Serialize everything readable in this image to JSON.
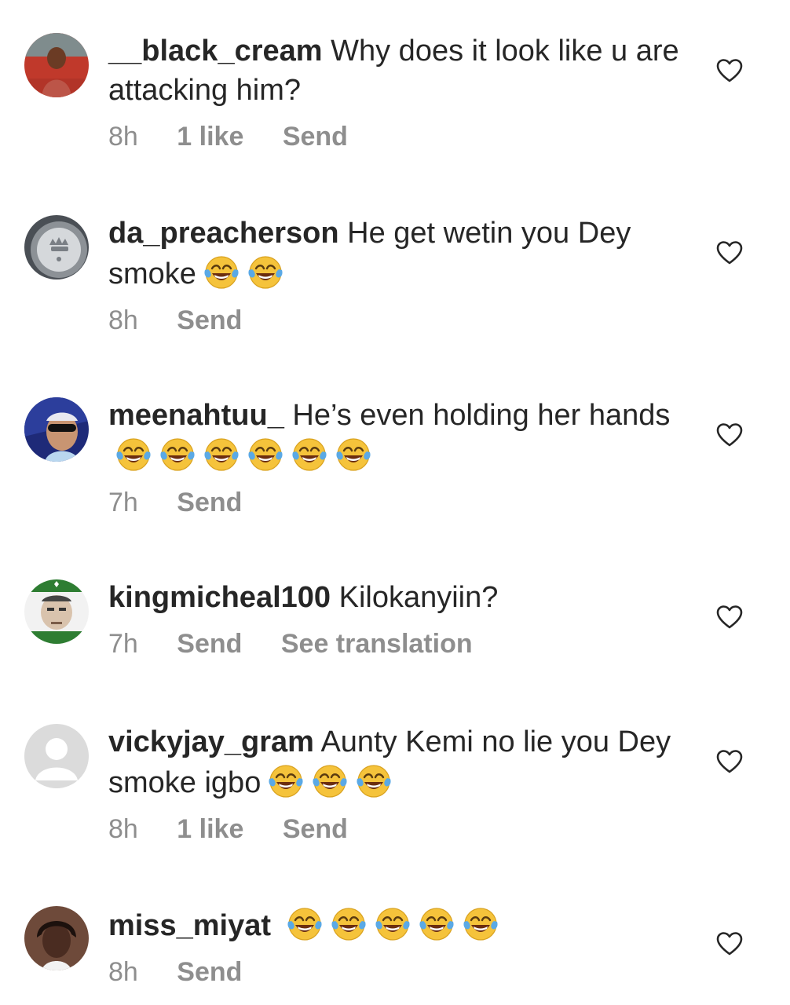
{
  "comments": [
    {
      "username": "__black_cream",
      "text": "Why does it look like u are attacking him?",
      "emoji_count": 0,
      "time": "8h",
      "likes": "1 like",
      "reply": "Send",
      "translate": ""
    },
    {
      "username": "da_preacherson",
      "text": "He  get wetin you Dey smoke",
      "emoji_count": 2,
      "time": "8h",
      "likes": "",
      "reply": "Send",
      "translate": ""
    },
    {
      "username": "meenahtuu_",
      "text": "He’s even holding her hands",
      "emoji_count": 6,
      "time": "7h",
      "likes": "",
      "reply": "Send",
      "translate": ""
    },
    {
      "username": "kingmicheal100",
      "text": "Kilokanyiin?",
      "emoji_count": 0,
      "time": "7h",
      "likes": "",
      "reply": "Send",
      "translate": "See translation"
    },
    {
      "username": "vickyjay_gram",
      "text": "Aunty Kemi no lie you Dey smoke igbo",
      "emoji_count": 3,
      "time": "8h",
      "likes": "1 like",
      "reply": "Send",
      "translate": ""
    },
    {
      "username": "miss_miyat",
      "text": "",
      "emoji_count": 5,
      "time": "8h",
      "likes": "",
      "reply": "Send",
      "translate": ""
    }
  ],
  "icons": {
    "emoji": "face-with-tears-of-joy-icon",
    "like": "heart-outline-icon"
  },
  "colors": {
    "text": "#262626",
    "meta": "#8e8e8e",
    "emoji_face": "#F5C33B",
    "tears": "#5AA9E6"
  }
}
